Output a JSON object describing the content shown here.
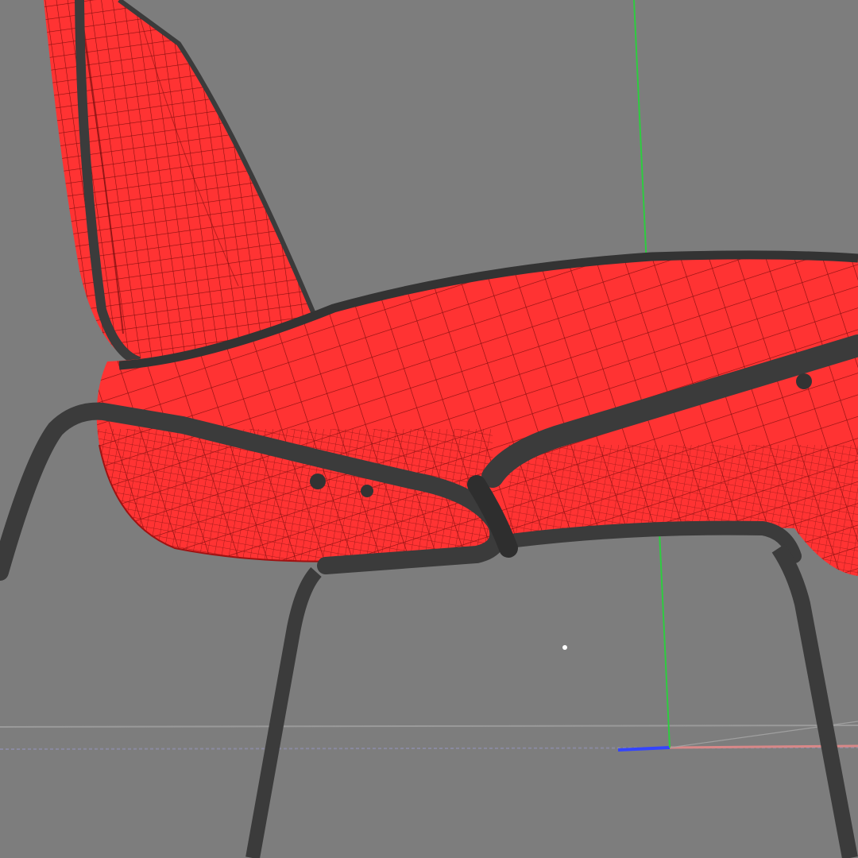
{
  "viewport": {
    "background_color": "#7d7d7d",
    "shading_mode": "wireframe-on-shaded"
  },
  "scene_object": {
    "type": "lounge-chair",
    "shell_color": "#ff3030",
    "wire_color": "#8a1010",
    "frame_color": "#3b3b3b"
  },
  "axes": {
    "y_axis_color": "#2ecc40",
    "x_axis_color": "#d88888",
    "z_axis_color": "#3344ff",
    "grid_line_color": "#9a9a9a"
  }
}
